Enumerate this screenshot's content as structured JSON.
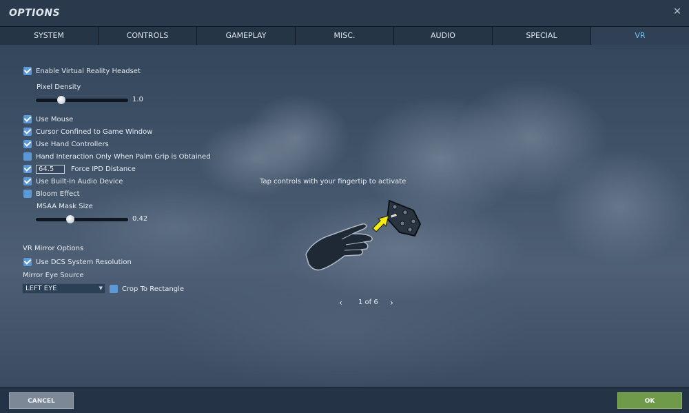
{
  "window": {
    "title": "OPTIONS",
    "close_glyph": "✕"
  },
  "tabs": [
    {
      "label": "SYSTEM"
    },
    {
      "label": "CONTROLS"
    },
    {
      "label": "GAMEPLAY"
    },
    {
      "label": "MISC."
    },
    {
      "label": "AUDIO"
    },
    {
      "label": "SPECIAL"
    },
    {
      "label": "VR",
      "active": true
    }
  ],
  "settings": {
    "enable_vr": {
      "label": "Enable Virtual Reality Headset",
      "checked": true
    },
    "pixel_density": {
      "label": "Pixel Density",
      "value": "1.0",
      "fraction": 0.25
    },
    "use_mouse": {
      "label": "Use Mouse",
      "checked": true
    },
    "cursor_confined": {
      "label": "Cursor Confined to Game Window",
      "checked": true
    },
    "hand_controllers": {
      "label": "Use Hand Controllers",
      "checked": true
    },
    "palm_grip": {
      "label": "Hand Interaction Only When Palm Grip is Obtained",
      "checked": false
    },
    "force_ipd": {
      "label": "Force IPD Distance",
      "checked": true,
      "value": "64.5"
    },
    "builtin_audio": {
      "label": "Use Built-In Audio Device",
      "checked": true
    },
    "bloom": {
      "label": "Bloom Effect",
      "checked": false
    },
    "msaa_mask": {
      "label": "MSAA Mask Size",
      "value": "0.42",
      "fraction": 0.36
    },
    "mirror_section": {
      "label": "VR Mirror Options"
    },
    "dcs_resolution": {
      "label": "Use DCS System Resolution",
      "checked": true
    },
    "mirror_eye": {
      "label": "Mirror Eye Source",
      "selected": "LEFT EYE"
    },
    "crop_rect": {
      "label": "Crop To Rectangle",
      "checked": false
    }
  },
  "tutorial": {
    "hint": "Tap controls with your fingertip to activate",
    "page": "1 of 6",
    "prev_glyph": "‹",
    "next_glyph": "›"
  },
  "footer": {
    "cancel_label": "CANCEL",
    "ok_label": "OK"
  },
  "colors": {
    "accent": "#78c0ee",
    "checkbox": "#5b9ad6",
    "ok_button": "#6f9a49",
    "cancel_button": "#7c8895"
  }
}
